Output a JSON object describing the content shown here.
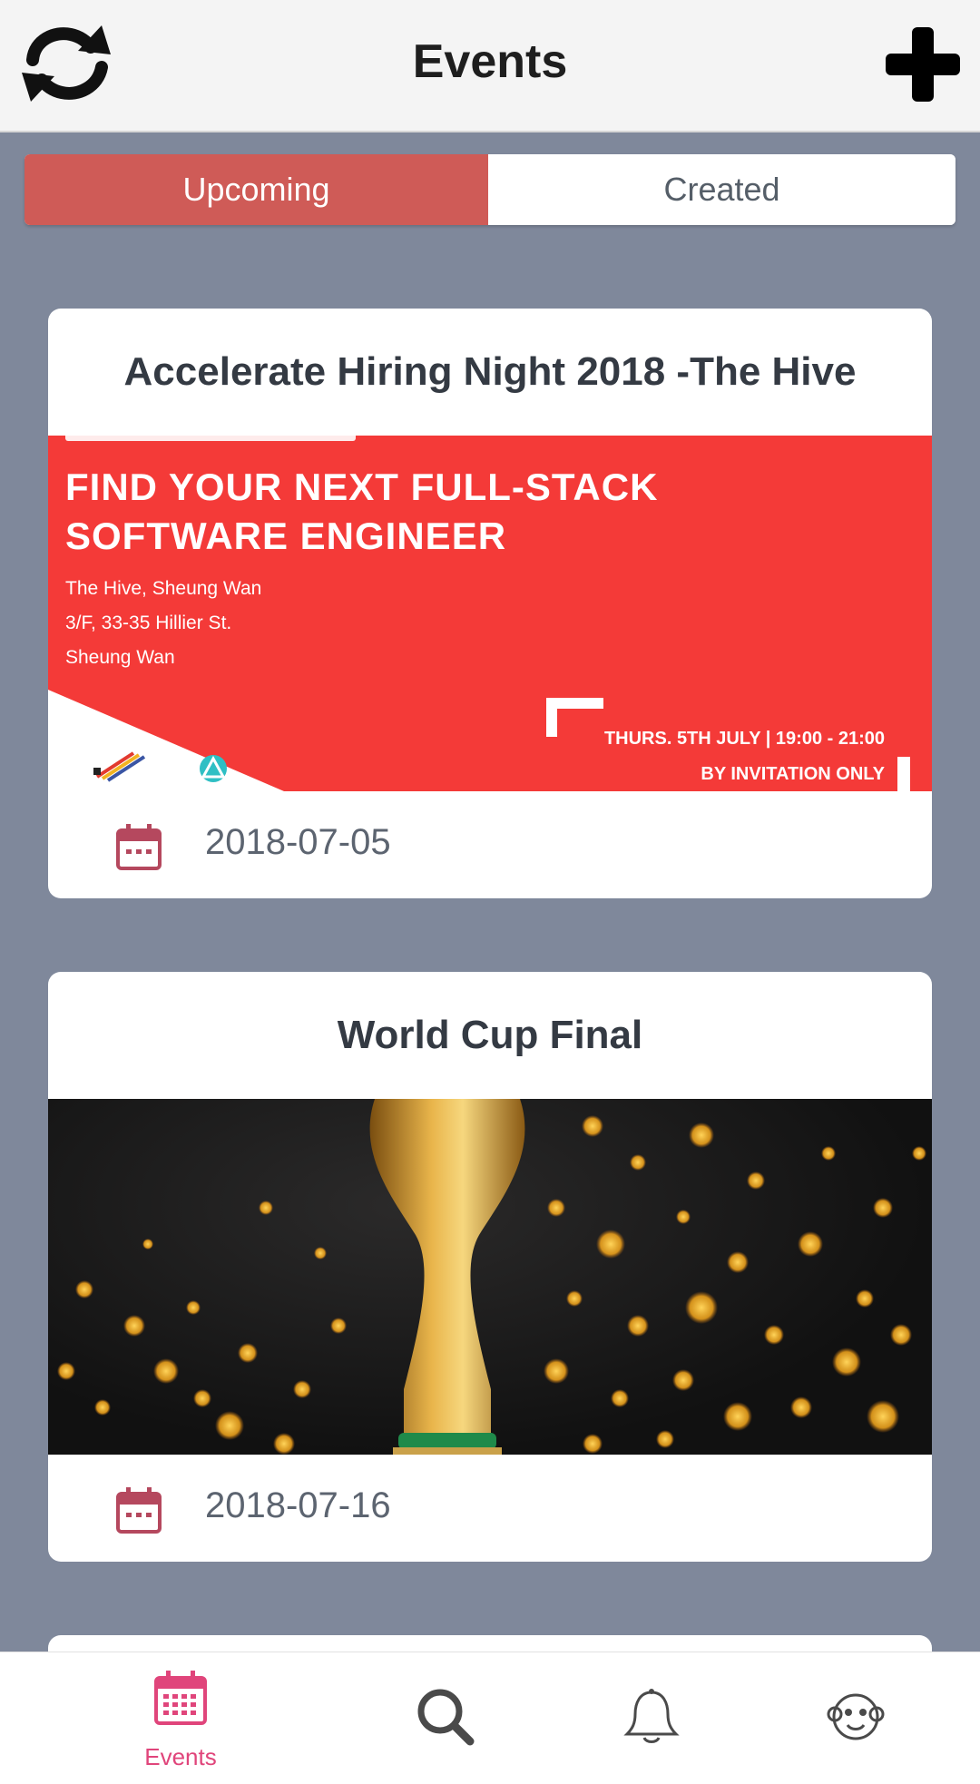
{
  "header": {
    "title": "Events",
    "refresh_icon": "refresh-icon",
    "add_icon": "plus-icon"
  },
  "segments": {
    "upcoming_label": "Upcoming",
    "created_label": "Created",
    "selected": "Upcoming"
  },
  "events": [
    {
      "title": "Accelerate Hiring Night 2018 -The Hive",
      "date": "2018-07-05",
      "banner": {
        "headline_1": "FIND YOUR NEXT FULL-STACK",
        "headline_2": "SOFTWARE ENGINEER",
        "address_1": "The Hive, Sheung Wan",
        "address_2": "3/F, 33-35 Hillier St.",
        "address_3": "Sheung Wan",
        "when": "THURS. 5TH JULY | 19:00 - 21:00",
        "note": "BY INVITATION ONLY"
      }
    },
    {
      "title": "World Cup Final",
      "date": "2018-07-16"
    }
  ],
  "tabbar": {
    "events_label": "Events",
    "active": "Events"
  },
  "colors": {
    "accent_red": "#cf5b57",
    "tab_active": "#e0457b",
    "background": "#7f889b",
    "calendar_icon": "#b5485e"
  }
}
